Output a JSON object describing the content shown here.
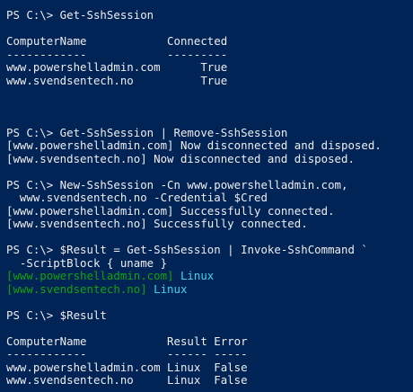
{
  "colors": {
    "background": "#012456",
    "foreground": "#eeedf0",
    "green": "#13a10e",
    "cyan": "#3ad5f0"
  },
  "console": {
    "lines": [
      {
        "segments": [
          {
            "text": "PS C:\\> Get-SshSession",
            "color": "#eeedf0"
          }
        ]
      },
      {
        "segments": [
          {
            "text": "",
            "color": "#eeedf0"
          }
        ]
      },
      {
        "segments": [
          {
            "text": "ComputerName            Connected",
            "color": "#eeedf0"
          }
        ]
      },
      {
        "segments": [
          {
            "text": "------------            ---------",
            "color": "#eeedf0"
          }
        ]
      },
      {
        "segments": [
          {
            "text": "www.powershelladmin.com      True",
            "color": "#eeedf0"
          }
        ]
      },
      {
        "segments": [
          {
            "text": "www.svendsentech.no          True",
            "color": "#eeedf0"
          }
        ]
      },
      {
        "segments": [
          {
            "text": "",
            "color": "#eeedf0"
          }
        ]
      },
      {
        "segments": [
          {
            "text": "",
            "color": "#eeedf0"
          }
        ]
      },
      {
        "segments": [
          {
            "text": "",
            "color": "#eeedf0"
          }
        ]
      },
      {
        "segments": [
          {
            "text": "PS C:\\> Get-SshSession | Remove-SshSession",
            "color": "#eeedf0"
          }
        ]
      },
      {
        "segments": [
          {
            "text": "[www.powershelladmin.com] Now disconnected and disposed.",
            "color": "#eeedf0"
          }
        ]
      },
      {
        "segments": [
          {
            "text": "[www.svendsentech.no] Now disconnected and disposed.",
            "color": "#eeedf0"
          }
        ]
      },
      {
        "segments": [
          {
            "text": "",
            "color": "#eeedf0"
          }
        ]
      },
      {
        "segments": [
          {
            "text": "PS C:\\> New-SshSession -Cn www.powershelladmin.com,",
            "color": "#eeedf0"
          }
        ]
      },
      {
        "segments": [
          {
            "text": "  www.svendsentech.no -Credential $Cred",
            "color": "#eeedf0"
          }
        ]
      },
      {
        "segments": [
          {
            "text": "[www.powershelladmin.com] Successfully connected.",
            "color": "#eeedf0"
          }
        ]
      },
      {
        "segments": [
          {
            "text": "[www.svendsentech.no] Successfully connected.",
            "color": "#eeedf0"
          }
        ]
      },
      {
        "segments": [
          {
            "text": "",
            "color": "#eeedf0"
          }
        ]
      },
      {
        "segments": [
          {
            "text": "PS C:\\> $Result = Get-SshSession | Invoke-SshCommand `",
            "color": "#eeedf0"
          }
        ]
      },
      {
        "segments": [
          {
            "text": "  -ScriptBlock { uname }",
            "color": "#eeedf0"
          }
        ]
      },
      {
        "segments": [
          {
            "text": "[www.powershelladmin.com]",
            "color": "#13a10e"
          },
          {
            "text": " Linux",
            "color": "#3ad5f0"
          }
        ]
      },
      {
        "segments": [
          {
            "text": "[www.svendsentech.no]",
            "color": "#13a10e"
          },
          {
            "text": " Linux",
            "color": "#3ad5f0"
          }
        ]
      },
      {
        "segments": [
          {
            "text": "",
            "color": "#eeedf0"
          }
        ]
      },
      {
        "segments": [
          {
            "text": "PS C:\\> $Result",
            "color": "#eeedf0"
          }
        ]
      },
      {
        "segments": [
          {
            "text": "",
            "color": "#eeedf0"
          }
        ]
      },
      {
        "segments": [
          {
            "text": "ComputerName            Result Error",
            "color": "#eeedf0"
          }
        ]
      },
      {
        "segments": [
          {
            "text": "------------            ------ -----",
            "color": "#eeedf0"
          }
        ]
      },
      {
        "segments": [
          {
            "text": "www.powershelladmin.com Linux  False",
            "color": "#eeedf0"
          }
        ]
      },
      {
        "segments": [
          {
            "text": "www.svendsentech.no     Linux  False",
            "color": "#eeedf0"
          }
        ]
      }
    ]
  }
}
